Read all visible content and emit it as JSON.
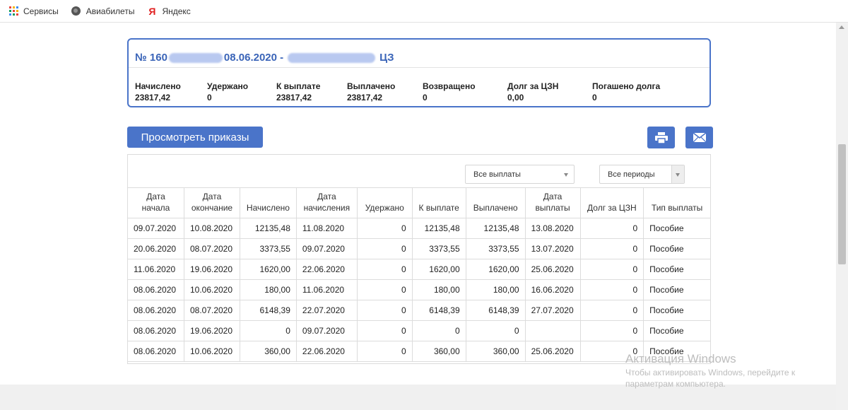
{
  "bookmarks": [
    {
      "label": "Сервисы",
      "icon": "apps-grid-icon"
    },
    {
      "label": "Авиабилеты",
      "icon": "globe-icon"
    },
    {
      "label": "Яндекс",
      "icon": "yandex-icon"
    }
  ],
  "card": {
    "title_prefix": "№ 160",
    "title_middle": "08.06.2020 -",
    "title_suffix": "ЦЗ",
    "stats": [
      {
        "label": "Начислено",
        "value": "23817,42"
      },
      {
        "label": "Удержано",
        "value": "0"
      },
      {
        "label": "К выплате",
        "value": "23817,42"
      },
      {
        "label": "Выплачено",
        "value": "23817,42"
      },
      {
        "label": "Возвращено",
        "value": "0"
      },
      {
        "label": "Долг за ЦЗН",
        "value": "0,00"
      },
      {
        "label": "Погашено долга",
        "value": "0"
      }
    ]
  },
  "actions": {
    "view_orders": "Просмотреть приказы",
    "print_icon": "printer-icon",
    "mail_icon": "envelope-icon"
  },
  "filters": {
    "payments": "Все выплаты",
    "periods": "Все периоды"
  },
  "table": {
    "headers": [
      "Дата начала",
      "Дата окончание",
      "Начислено",
      "Дата начисления",
      "Удержано",
      "К выплате",
      "Выплачено",
      "Дата выплаты",
      "Долг за ЦЗН",
      "Тип выплаты"
    ],
    "rows": [
      [
        "09.07.2020",
        "10.08.2020",
        "12135,48",
        "11.08.2020",
        "0",
        "12135,48",
        "12135,48",
        "13.08.2020",
        "0",
        "Пособие"
      ],
      [
        "20.06.2020",
        "08.07.2020",
        "3373,55",
        "09.07.2020",
        "0",
        "3373,55",
        "3373,55",
        "13.07.2020",
        "0",
        "Пособие"
      ],
      [
        "11.06.2020",
        "19.06.2020",
        "1620,00",
        "22.06.2020",
        "0",
        "1620,00",
        "1620,00",
        "25.06.2020",
        "0",
        "Пособие"
      ],
      [
        "08.06.2020",
        "10.06.2020",
        "180,00",
        "11.06.2020",
        "0",
        "180,00",
        "180,00",
        "16.06.2020",
        "0",
        "Пособие"
      ],
      [
        "08.06.2020",
        "08.07.2020",
        "6148,39",
        "22.07.2020",
        "0",
        "6148,39",
        "6148,39",
        "27.07.2020",
        "0",
        "Пособие"
      ],
      [
        "08.06.2020",
        "19.06.2020",
        "0",
        "09.07.2020",
        "0",
        "0",
        "0",
        "",
        "0",
        "Пособие"
      ],
      [
        "08.06.2020",
        "10.06.2020",
        "360,00",
        "22.06.2020",
        "0",
        "360,00",
        "360,00",
        "25.06.2020",
        "0",
        "Пособие"
      ]
    ]
  },
  "watermark": {
    "title": "Активация Windows",
    "line1": "Чтобы активировать Windows, перейдите к",
    "line2": "параметрам компьютера."
  },
  "colors": {
    "accent": "#4a74c9",
    "title_text": "#3a64b8"
  }
}
